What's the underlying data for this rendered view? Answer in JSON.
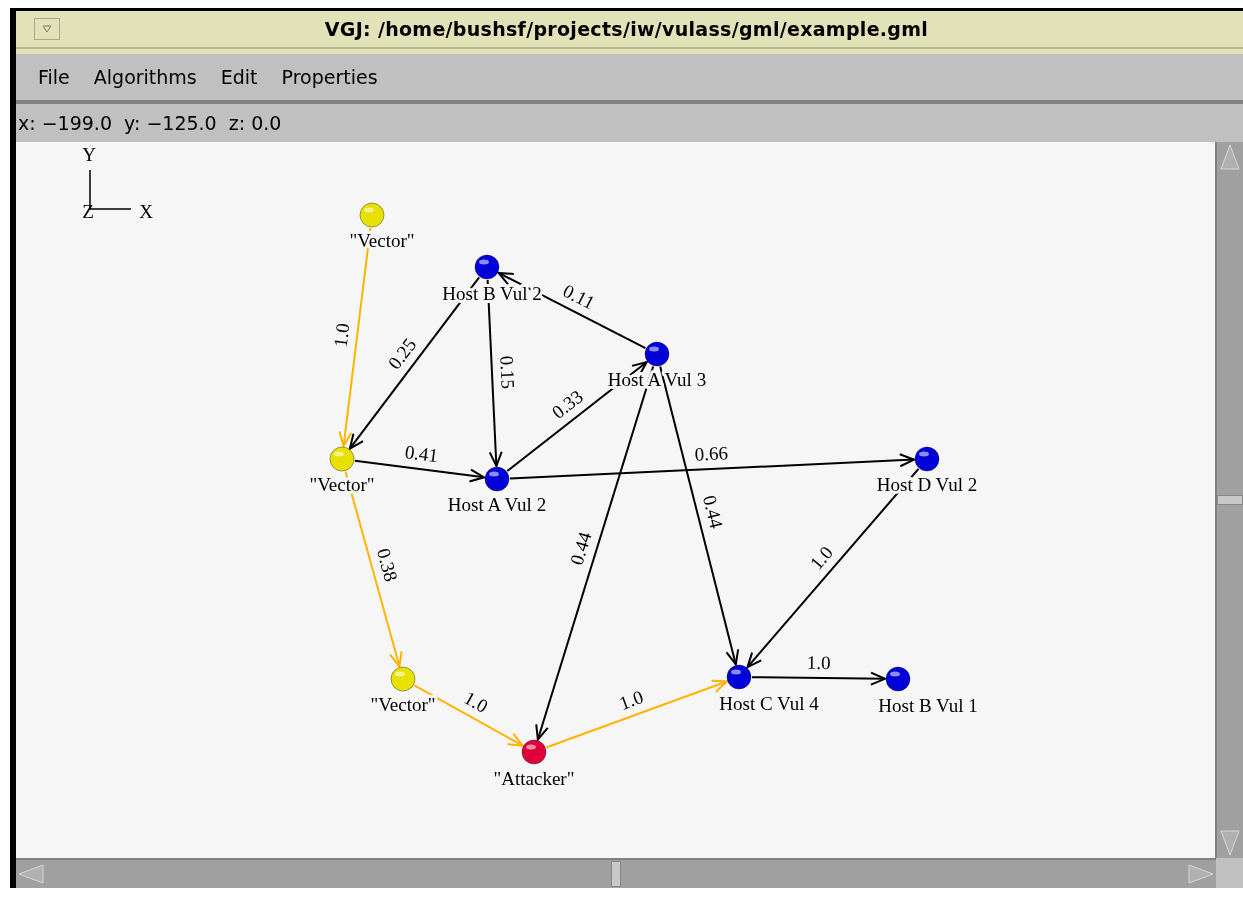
{
  "window": {
    "title": "VGJ:  /home/bushsf/projects/iw/vulass/gml/example.gml"
  },
  "menu": [
    "File",
    "Algorithms",
    "Edit",
    "Properties"
  ],
  "coordinates": "x: −199.0  y: −125.0  z: 0.0",
  "axes": {
    "y": "Y",
    "z": "Z",
    "x": "X"
  },
  "nodes": [
    {
      "label": "\"Vector\"",
      "color": "#e8e000"
    },
    {
      "label": "Host B Vul 2",
      "color": "#0000d8"
    },
    {
      "label": "Host A Vul 3",
      "color": "#0000d8"
    },
    {
      "label": "\"Vector\"",
      "color": "#e8e000"
    },
    {
      "label": "Host A Vul 2",
      "color": "#0000d8"
    },
    {
      "label": "Host D Vul 2",
      "color": "#0000d8"
    },
    {
      "label": "\"Vector\"",
      "color": "#e8e000"
    },
    {
      "label": "\"Attacker\"",
      "color": "#e0003c"
    },
    {
      "label": "Host C Vul 4",
      "color": "#0000d8"
    },
    {
      "label": "Host B Vul 1",
      "color": "#0000d8"
    }
  ],
  "edges": [
    {
      "label": "1.0",
      "color": "#ffb400"
    },
    {
      "label": "0.25",
      "color": "#000000"
    },
    {
      "label": "0.15",
      "color": "#000000"
    },
    {
      "label": "0.11",
      "color": "#000000"
    },
    {
      "label": "0.33",
      "color": "#000000"
    },
    {
      "label": "0.41",
      "color": "#000000"
    },
    {
      "label": "0.66",
      "color": "#000000"
    },
    {
      "label": "0.44",
      "color": "#000000"
    },
    {
      "label": "0.44",
      "color": "#000000"
    },
    {
      "label": "0.38",
      "color": "#ffb400"
    },
    {
      "label": "1.0",
      "color": "#ffb400"
    },
    {
      "label": "1.0",
      "color": "#ffb400"
    },
    {
      "label": "1.0",
      "color": "#000000"
    },
    {
      "label": "1.0",
      "color": "#000000"
    }
  ]
}
